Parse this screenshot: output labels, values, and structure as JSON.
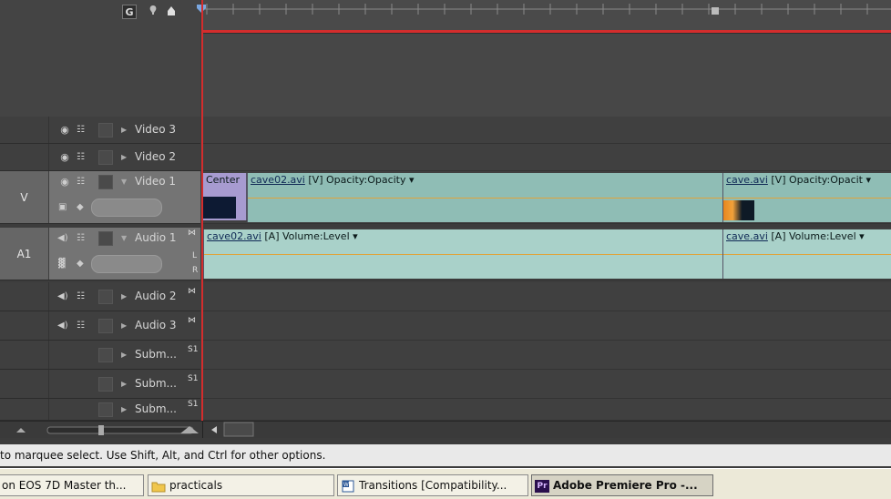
{
  "colors": {
    "playhead": "#d32d2d",
    "clip_video": "#8fbdb5",
    "clip_audio": "#a9d1c9",
    "transition": "#a79bd0"
  },
  "header": {
    "snap_label": "G"
  },
  "tracks": [
    {
      "name": "Video 3",
      "kind": "video"
    },
    {
      "name": "Video 2",
      "kind": "video"
    },
    {
      "name": "Video 1",
      "kind": "video",
      "tag": "V"
    },
    {
      "name": "Audio 1",
      "kind": "audio",
      "tag": "A1",
      "lr_top": "L",
      "lr_bottom": "R"
    },
    {
      "name": "Audio 2",
      "kind": "audio"
    },
    {
      "name": "Audio 3",
      "kind": "audio"
    },
    {
      "name": "Subm...",
      "kind": "submix",
      "badge": "S1"
    },
    {
      "name": "Subm...",
      "kind": "submix",
      "badge": "S1"
    },
    {
      "name": "Subm...",
      "kind": "submix",
      "badge": "S1"
    }
  ],
  "clips": {
    "transition_label": "Center",
    "v1_a_name": "cave02.avi",
    "v1_a_suffix": "[V] Opacity:Opacity",
    "v1_b_name": "cave.avi",
    "v1_b_suffix": "[V] Opacity:Opacit",
    "a1_a_name": "cave02.avi",
    "a1_a_suffix": "[A] Volume:Level",
    "a1_b_name": "cave.avi",
    "a1_b_suffix": "[A] Volume:Level"
  },
  "status_bar": {
    "text": "to marquee select. Use Shift, Alt, and Ctrl for other options."
  },
  "taskbar": {
    "items": [
      {
        "label": "on EOS 7D Master th..."
      },
      {
        "label": "practicals"
      },
      {
        "label": "Transitions [Compatibility..."
      },
      {
        "label": "Adobe Premiere Pro -..."
      }
    ],
    "active_badge": "Pr"
  }
}
